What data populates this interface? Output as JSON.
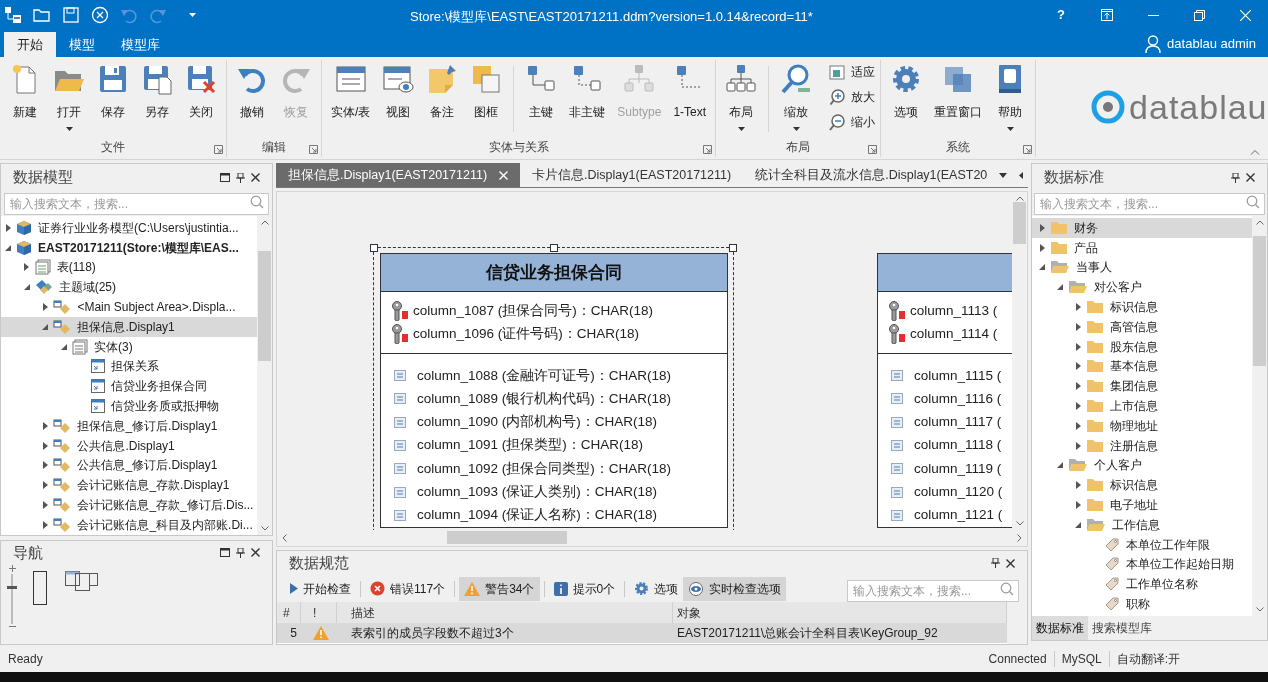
{
  "window": {
    "title": "Store:\\模型库\\EAST\\EAST20171211.ddm?version=1.0.14&record=11*",
    "help": "?"
  },
  "quick_access": [
    {
      "kind": "diagram",
      "disabled": false
    },
    {
      "kind": "open",
      "disabled": false
    },
    {
      "kind": "save",
      "disabled": false
    },
    {
      "kind": "close",
      "disabled": false
    },
    {
      "kind": "undo",
      "disabled": true
    },
    {
      "kind": "redo",
      "disabled": true
    }
  ],
  "ribbon": {
    "tabs": [
      {
        "label": "开始",
        "selected": true
      },
      {
        "label": "模型",
        "selected": false
      },
      {
        "label": "模型库",
        "selected": false
      }
    ],
    "user": "datablau admin",
    "groups": [
      {
        "label": "文件",
        "sections": [
          [
            {
              "label": "新建",
              "kind": "new",
              "dropdown": false,
              "disabled": false
            },
            {
              "label": "打开",
              "kind": "open",
              "dropdown": true,
              "disabled": false
            },
            {
              "label": "保存",
              "kind": "save",
              "dropdown": false,
              "disabled": false
            },
            {
              "label": "另存",
              "kind": "saveas",
              "dropdown": false,
              "disabled": false
            },
            {
              "label": "关闭",
              "kind": "close",
              "dropdown": false,
              "disabled": false
            }
          ]
        ]
      },
      {
        "label": "编辑",
        "sections": [
          [
            {
              "label": "撤销",
              "kind": "undo",
              "dropdown": false,
              "disabled": false
            },
            {
              "label": "恢复",
              "kind": "redo",
              "dropdown": false,
              "disabled": true
            }
          ]
        ]
      },
      {
        "label": "实体与关系",
        "sections": [
          [
            {
              "label": "实体/表",
              "kind": "entity",
              "dropdown": false,
              "disabled": false
            },
            {
              "label": "视图",
              "kind": "view",
              "dropdown": false,
              "disabled": false
            },
            {
              "label": "备注",
              "kind": "note",
              "dropdown": false,
              "disabled": false
            },
            {
              "label": "图框",
              "kind": "frame",
              "dropdown": false,
              "disabled": false
            }
          ],
          [
            {
              "label": "主键",
              "kind": "pk",
              "dropdown": false,
              "disabled": false
            },
            {
              "label": "非主键",
              "kind": "nonpk",
              "dropdown": false,
              "disabled": false
            },
            {
              "label": "Subtype",
              "kind": "subtype",
              "dropdown": false,
              "disabled": true
            },
            {
              "label": "1-Text",
              "kind": "text",
              "dropdown": false,
              "disabled": false
            }
          ]
        ]
      },
      {
        "label": "布局",
        "sections": [
          [
            {
              "label": "布局",
              "kind": "layout",
              "dropdown": true,
              "disabled": false
            }
          ],
          [
            {
              "label": "缩放",
              "kind": "zoom",
              "dropdown": true,
              "disabled": false
            },
            {
              "label": "适应",
              "kind": "fit",
              "dropdown": false,
              "disabled": false
            },
            {
              "label": "放大",
              "kind": "zoomin",
              "dropdown": false,
              "disabled": false
            },
            {
              "label": "缩小",
              "kind": "zoomout",
              "dropdown": false,
              "disabled": false
            }
          ]
        ]
      },
      {
        "label": "系统",
        "sections": [
          [
            {
              "label": "选项",
              "kind": "options",
              "dropdown": false,
              "disabled": false
            },
            {
              "label": "重置窗口",
              "kind": "reset",
              "dropdown": false,
              "disabled": false
            },
            {
              "label": "帮助",
              "kind": "help",
              "dropdown": true,
              "disabled": false
            }
          ]
        ]
      }
    ],
    "logo": "datablau"
  },
  "model_panel": {
    "title": "数据模型",
    "search": {
      "placeholder": "输入搜索文本，搜索..."
    },
    "tree": [
      {
        "label": "证券行业业务模型(C:\\Users\\justintia...",
        "kind": "model",
        "bold": false,
        "expanded": false,
        "selected": false
      },
      {
        "label": "EAST20171211(Store:\\模型库\\EAS...",
        "kind": "model",
        "bold": true,
        "expanded": true,
        "selected": false,
        "children": [
          {
            "label": "表(118)",
            "kind": "tables",
            "expanded": false,
            "selected": false
          },
          {
            "label": "主题域(25)",
            "kind": "subjects",
            "expanded": true,
            "selected": false,
            "children": [
              {
                "label": "<Main Subject Area>.Displa...",
                "kind": "diagram",
                "expanded": false,
                "selected": false
              },
              {
                "label": "担保信息.Display1",
                "kind": "diagram",
                "expanded": true,
                "selected": true,
                "children": [
                  {
                    "label": "实体(3)",
                    "kind": "entities",
                    "expanded": true,
                    "selected": false,
                    "children": [
                      {
                        "label": "担保关系",
                        "kind": "entity",
                        "selected": false
                      },
                      {
                        "label": "信贷业务担保合同",
                        "kind": "entity",
                        "selected": false
                      },
                      {
                        "label": "信贷业务质或抵押物",
                        "kind": "entity",
                        "selected": false
                      }
                    ]
                  }
                ]
              },
              {
                "label": "担保信息_修订后.Display1",
                "kind": "diagram",
                "expanded": false,
                "selected": false
              },
              {
                "label": "公共信息.Display1",
                "kind": "diagram",
                "expanded": false,
                "selected": false
              },
              {
                "label": "公共信息_修订后.Display1",
                "kind": "diagram",
                "expanded": false,
                "selected": false
              },
              {
                "label": "会计记账信息_存款.Display1",
                "kind": "diagram",
                "expanded": false,
                "selected": false
              },
              {
                "label": "会计记账信息_存款_修订后.Dis...",
                "kind": "diagram",
                "expanded": false,
                "selected": false
              },
              {
                "label": "会计记账信息_科目及内部账.Di...",
                "kind": "diagram",
                "expanded": false,
                "selected": false
              }
            ]
          }
        ]
      }
    ]
  },
  "navigation_panel": {
    "title": "导航",
    "zoom_slider": {
      "level": 0.73
    }
  },
  "document_tabs": [
    {
      "label": "担保信息.Display1(EAST20171211)",
      "selected": true
    },
    {
      "label": "卡片信息.Display1(EAST20171211)",
      "selected": false
    },
    {
      "label": "统计全科目及流水信息.Display1(EAST20",
      "selected": false
    }
  ],
  "diagram": {
    "entities": [
      {
        "title": "信贷业务担保合同",
        "selected": true,
        "keys": [
          "column_1087 (担保合同号)：CHAR(18)",
          "column_1096 (证件号码)：CHAR(18)"
        ],
        "columns": [
          "column_1088 (金融许可证号)：CHAR(18)",
          "column_1089 (银行机构代码)：CHAR(18)",
          "column_1090 (内部机构号)：CHAR(18)",
          "column_1091 (担保类型)：CHAR(18)",
          "column_1092 (担保合同类型)：CHAR(18)",
          "column_1093 (保证人类别)：CHAR(18)",
          "column_1094 (保证人名称)：CHAR(18)"
        ]
      },
      {
        "selected": false,
        "keys": [
          "column_1113 (",
          "column_1114 ("
        ],
        "columns": [
          "column_1115 (",
          "column_1116 (",
          "column_1117 (",
          "column_1118 (",
          "column_1119 (",
          "column_1120 (",
          "column_1121 ("
        ]
      }
    ]
  },
  "rules_panel": {
    "title": "数据规范",
    "toolbar": [
      {
        "label": "开始检查",
        "kind": "start",
        "selected": false
      },
      {
        "label": "错误117个",
        "kind": "error",
        "selected": false
      },
      {
        "label": "警告34个",
        "kind": "warning",
        "selected": true
      },
      {
        "label": "提示0个",
        "kind": "info",
        "selected": false
      },
      {
        "label": "选项",
        "kind": "options",
        "selected": false
      },
      {
        "label": "实时检查选项",
        "kind": "live",
        "selected": true
      }
    ],
    "search": {
      "placeholder": "输入搜索文本，搜索..."
    },
    "columns": [
      "#",
      "!",
      "描述",
      "对象"
    ],
    "rows": [
      {
        "number": "5",
        "kind": "warning",
        "description": "表索引的成员字段数不超过3个",
        "object": "EAST20171211\\总账会计全科目表\\KeyGroup_92"
      }
    ]
  },
  "standards_panel": {
    "title": "数据标准",
    "search": {
      "placeholder": "输入搜索文本，搜索..."
    },
    "tree": [
      {
        "label": "财务",
        "kind": "folder",
        "expanded": false,
        "selected": true
      },
      {
        "label": "产品",
        "kind": "folder",
        "expanded": false,
        "selected": false
      },
      {
        "label": "当事人",
        "kind": "folder",
        "expanded": true,
        "selected": false,
        "children": [
          {
            "label": "对公客户",
            "kind": "folder",
            "expanded": true,
            "selected": false,
            "children": [
              {
                "label": "标识信息",
                "kind": "folder",
                "expanded": false,
                "selected": false
              },
              {
                "label": "高管信息",
                "kind": "folder",
                "expanded": false,
                "selected": false
              },
              {
                "label": "股东信息",
                "kind": "folder",
                "expanded": false,
                "selected": false
              },
              {
                "label": "基本信息",
                "kind": "folder",
                "expanded": false,
                "selected": false
              },
              {
                "label": "集团信息",
                "kind": "folder",
                "expanded": false,
                "selected": false
              },
              {
                "label": "上市信息",
                "kind": "folder",
                "expanded": false,
                "selected": false
              },
              {
                "label": "物理地址",
                "kind": "folder",
                "expanded": false,
                "selected": false
              },
              {
                "label": "注册信息",
                "kind": "folder",
                "expanded": false,
                "selected": false
              }
            ]
          },
          {
            "label": "个人客户",
            "kind": "folder",
            "expanded": true,
            "selected": false,
            "children": [
              {
                "label": "标识信息",
                "kind": "folder",
                "expanded": false,
                "selected": false
              },
              {
                "label": "电子地址",
                "kind": "folder",
                "expanded": false,
                "selected": false
              },
              {
                "label": "工作信息",
                "kind": "folder",
                "expanded": true,
                "selected": false,
                "children": [
                  {
                    "label": "本单位工作年限",
                    "kind": "tag",
                    "selected": false
                  },
                  {
                    "label": "本单位工作起始日期",
                    "kind": "tag",
                    "selected": false
                  },
                  {
                    "label": "工作单位名称",
                    "kind": "tag",
                    "selected": false
                  },
                  {
                    "label": "职称",
                    "kind": "tag",
                    "selected": false
                  }
                ]
              }
            ]
          }
        ]
      }
    ],
    "tabs": [
      {
        "label": "数据标准",
        "selected": true
      },
      {
        "label": "搜索模型库",
        "selected": false
      }
    ]
  },
  "status_bar": {
    "message": "Ready",
    "items": [
      "Connected",
      "MySQL",
      "自动翻译:开"
    ]
  }
}
